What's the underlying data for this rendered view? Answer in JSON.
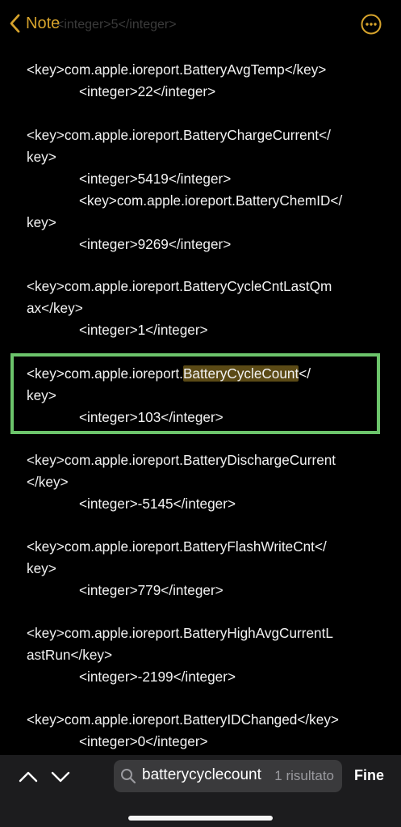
{
  "nav": {
    "back_label": "Note",
    "ghost_text": "<integer>5</integer>",
    "more_icon": "ellipsis-circle-icon",
    "accent_color": "#d6a32c"
  },
  "entries": [
    {
      "lines": [
        "<key>com.apple.ioreport.BatteryAvgTemp</key>",
        "<integer>22</integer>"
      ]
    },
    {
      "lines": [
        "<key>com.apple.ioreport.BatteryChargeCurrent</",
        "key>",
        "<integer>5419</integer>",
        "<key>com.apple.ioreport.BatteryChemID</",
        "key>",
        "<integer>9269</integer>"
      ]
    },
    {
      "lines": [
        "<key>com.apple.ioreport.BatteryCycleCntLastQm",
        "ax</key>",
        "<integer>1</integer>"
      ]
    },
    {
      "lines": [
        "<key>com.apple.ioreport.",
        "BatteryCycleCount",
        "</",
        "key>",
        "<integer>103</integer>"
      ]
    },
    {
      "lines": [
        "<key>com.apple.ioreport.BatteryDischargeCurrent",
        "</key>",
        "<integer>-5145</integer>"
      ]
    },
    {
      "lines": [
        "<key>com.apple.ioreport.BatteryFlashWriteCnt</",
        "key>",
        "<integer>779</integer>"
      ]
    },
    {
      "lines": [
        "<key>com.apple.ioreport.BatteryHighAvgCurrentL",
        "astRun</key>",
        "<integer>-2199</integer>"
      ]
    },
    {
      "lines": [
        "<key>com.apple.ioreport.BatteryIDChanged</key>",
        "<integer>0</integer>"
      ]
    }
  ],
  "find": {
    "query": "batterycyclecount",
    "result_count": "1 risultato",
    "done_label": "Fine",
    "match_border_color": "#6cc46b",
    "highlight_color": "#5b4a16"
  }
}
